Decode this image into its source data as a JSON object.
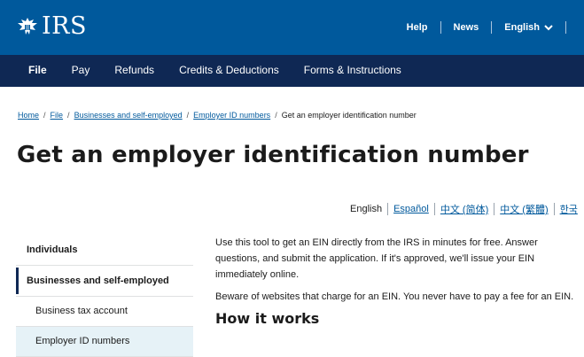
{
  "header": {
    "logo_text": "IRS",
    "utility_links": [
      "Help",
      "News"
    ],
    "language_label": "English"
  },
  "main_nav": {
    "items": [
      "File",
      "Pay",
      "Refunds",
      "Credits & Deductions",
      "Forms & Instructions"
    ],
    "active": "File"
  },
  "breadcrumb": {
    "links": [
      "Home",
      "File",
      "Businesses and self-employed",
      "Employer ID numbers"
    ],
    "current": "Get an employer identification number"
  },
  "page": {
    "title": "Get an employer identification number"
  },
  "languages": {
    "current": "English",
    "links": [
      "Español",
      "中文 (简体)",
      "中文 (繁體)",
      "한국"
    ]
  },
  "sidebar": {
    "heading": "Individuals",
    "active_section": "Businesses and self-employed",
    "items": [
      "Business tax account",
      "Employer ID numbers"
    ]
  },
  "content": {
    "intro": "Use this tool to get an EIN directly from the IRS in minutes for free. Answer questions, and submit the application. If it's approved, we'll issue your EIN immediately online.",
    "warning": "Beware of websites that charge for an EIN. You never have to pay a fee for an EIN.",
    "section_heading": "How it works"
  },
  "colors": {
    "header_blue": "#00599c",
    "nav_navy": "#0f2854",
    "link_blue": "#00599c",
    "sidebar_highlight": "#e6f2f7"
  }
}
